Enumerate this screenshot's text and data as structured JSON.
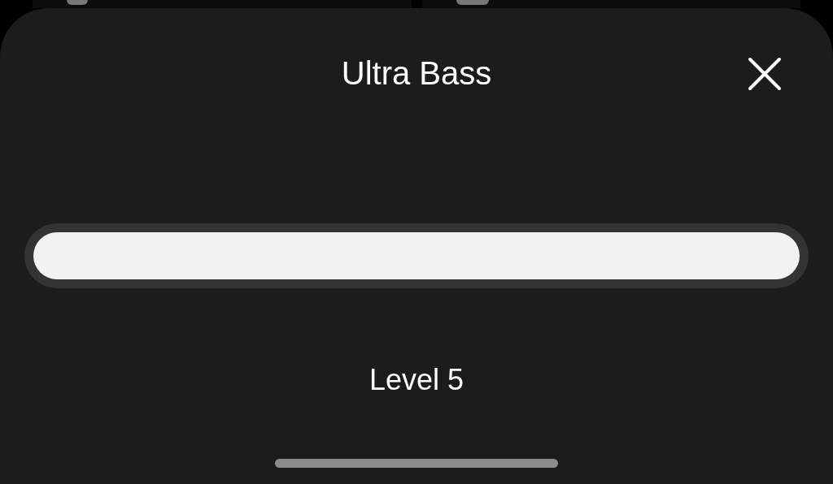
{
  "sheet": {
    "title": "Ultra Bass"
  },
  "reading": "Level 5"
}
